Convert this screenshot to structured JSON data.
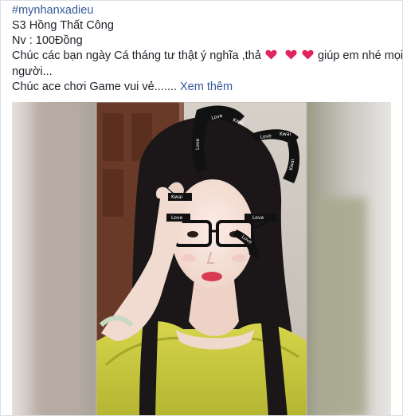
{
  "post": {
    "hashtag": "#mynhanxadieu",
    "line_server": "S3 Hồng Thất Công",
    "line_character": "Nv : 100Đồng",
    "wish_before_hearts": "Chúc các bạn ngày Cá tháng tư thật ý nghĩa ,thả",
    "wish_after_hearts": "giúp em nhé mọi",
    "wish_continued": "người...",
    "closing_text": "Chúc ace chơi Game vui vẻ.......",
    "see_more_label": "Xem thêm"
  },
  "hearts": {
    "count": 3,
    "color": "#e0245e"
  },
  "photo": {
    "sticker_text_love": "Love",
    "sticker_text_kwai": "Kwai",
    "colors": {
      "hair": "#1b1718",
      "top": "#c8c93e",
      "skin": "#f2ddd3",
      "wall": "#cfc9c2",
      "door": "#6a3a28"
    }
  },
  "colors": {
    "link": "#365899",
    "text": "#1d2129",
    "border": "#dddfe2"
  }
}
